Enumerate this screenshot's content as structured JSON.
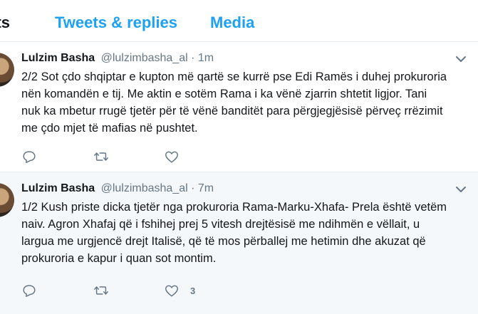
{
  "tabs": [
    {
      "label": "eets"
    },
    {
      "label": "Tweets & replies"
    },
    {
      "label": "Media"
    }
  ],
  "tweets": [
    {
      "name": "Lulzim Basha",
      "handle": "@lulzimbasha_al",
      "sep": "·",
      "time": "1m",
      "text": "2/2 Sot çdo shqiptar e kupton më qartë se kurrë pse Edi Ramës i duhej prokuroria\nnën komandën e tij. Me aktin e sotëm Rama i ka vënë zjarrin shtetit ligjor. Tani\nnuk ka mbetur rrugë tjetër për të vënë banditët para përgjegjësisë përveç rrëzimit\nme çdo mjet të mafias në pushtet.",
      "like_count": ""
    },
    {
      "name": "Lulzim Basha",
      "handle": "@lulzimbasha_al",
      "sep": "·",
      "time": "7m",
      "text": "1/2 Kush priste dicka tjetër nga prokuroria Rama-Marku-Xhafa- Prela është vetëm\nnaiv. Agron Xhafaj që i fshihej prej 5 vitesh drejtësisë me ndihmën e vëllait, u\nlargua me urgjencë drejt Italisë, që të mos përballej me hetimin dhe akuzat që\nprokuroria e kapur i quan sot montim.",
      "like_count": "3"
    }
  ],
  "colors": {
    "accent": "#1da1f2",
    "muted": "#657786",
    "text": "#14171a",
    "hover_bg": "#f5f8fa"
  },
  "icons": [
    "reply-icon",
    "retweet-icon",
    "like-icon",
    "chevron-down-icon"
  ]
}
